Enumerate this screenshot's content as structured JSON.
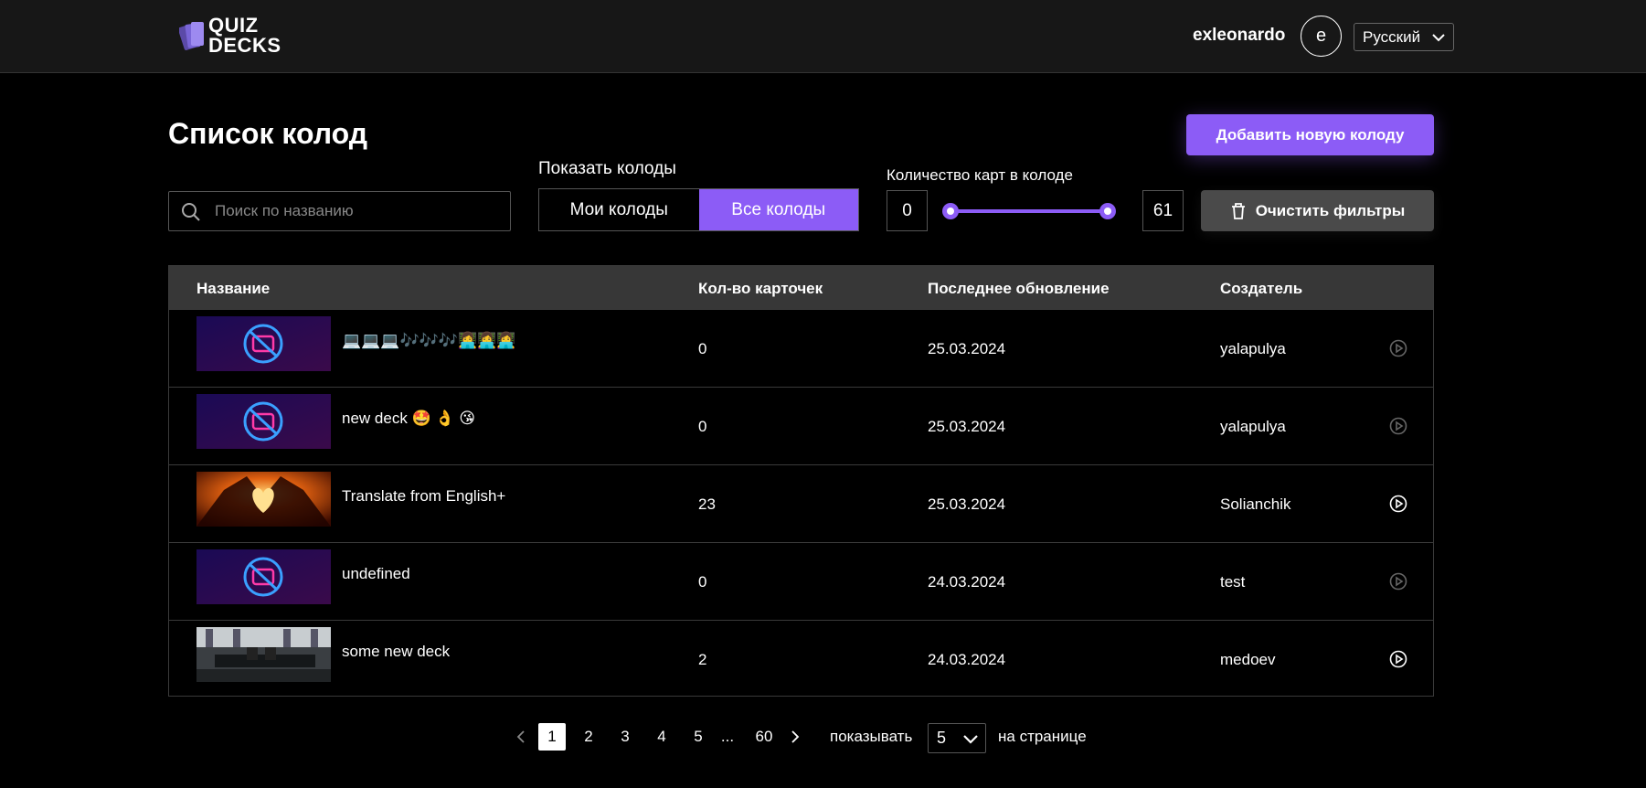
{
  "header": {
    "logo_line1": "QUIZ",
    "logo_line2": "DECKS",
    "username": "exleonardo",
    "avatar_letter": "e",
    "language": "Русский"
  },
  "page": {
    "title": "Список колод",
    "add_button": "Добавить новую колоду"
  },
  "filters": {
    "search_placeholder": "Поиск по названию",
    "show_label": "Показать колоды",
    "tabs": [
      {
        "label": "Мои колоды",
        "active": false
      },
      {
        "label": "Все колоды",
        "active": true
      }
    ],
    "range_label": "Количество карт в колоде",
    "range_min": "0",
    "range_max": "61",
    "slider_low_fraction": 0,
    "slider_high_fraction": 1,
    "clear_button": "Очистить фильтры"
  },
  "table": {
    "headers": [
      "Название",
      "Кол-во карточек",
      "Последнее обновление",
      "Создатель"
    ],
    "rows": [
      {
        "name": "💻💻💻🎶🎶🎶👩‍💻👩‍💻👩‍💻",
        "cards": "0",
        "updated": "25.03.2024",
        "creator": "yalapulya",
        "thumb": "no-image",
        "play_enabled": false
      },
      {
        "name": "new deck 🤩 👌 😘",
        "cards": "0",
        "updated": "25.03.2024",
        "creator": "yalapulya",
        "thumb": "no-image",
        "play_enabled": false
      },
      {
        "name": "Translate from English+",
        "cards": "23",
        "updated": "25.03.2024",
        "creator": "Solianchik",
        "thumb": "heart-hands",
        "play_enabled": true
      },
      {
        "name": "undefined",
        "cards": "0",
        "updated": "24.03.2024",
        "creator": "test",
        "thumb": "no-image",
        "play_enabled": false
      },
      {
        "name": "some new deck",
        "cards": "2",
        "updated": "24.03.2024",
        "creator": "medoev",
        "thumb": "office",
        "play_enabled": true
      }
    ]
  },
  "pagination": {
    "pages": [
      "1",
      "2",
      "3",
      "4",
      "5"
    ],
    "current": "1",
    "ellipsis": "...",
    "last": "60",
    "show_label": "показывать",
    "per_page": "5",
    "after_label": "на странице"
  },
  "colors": {
    "accent": "#8c5cf6",
    "header_bg": "#171717",
    "table_header_bg": "#373737",
    "clear_button_bg": "#4a4a4a"
  }
}
